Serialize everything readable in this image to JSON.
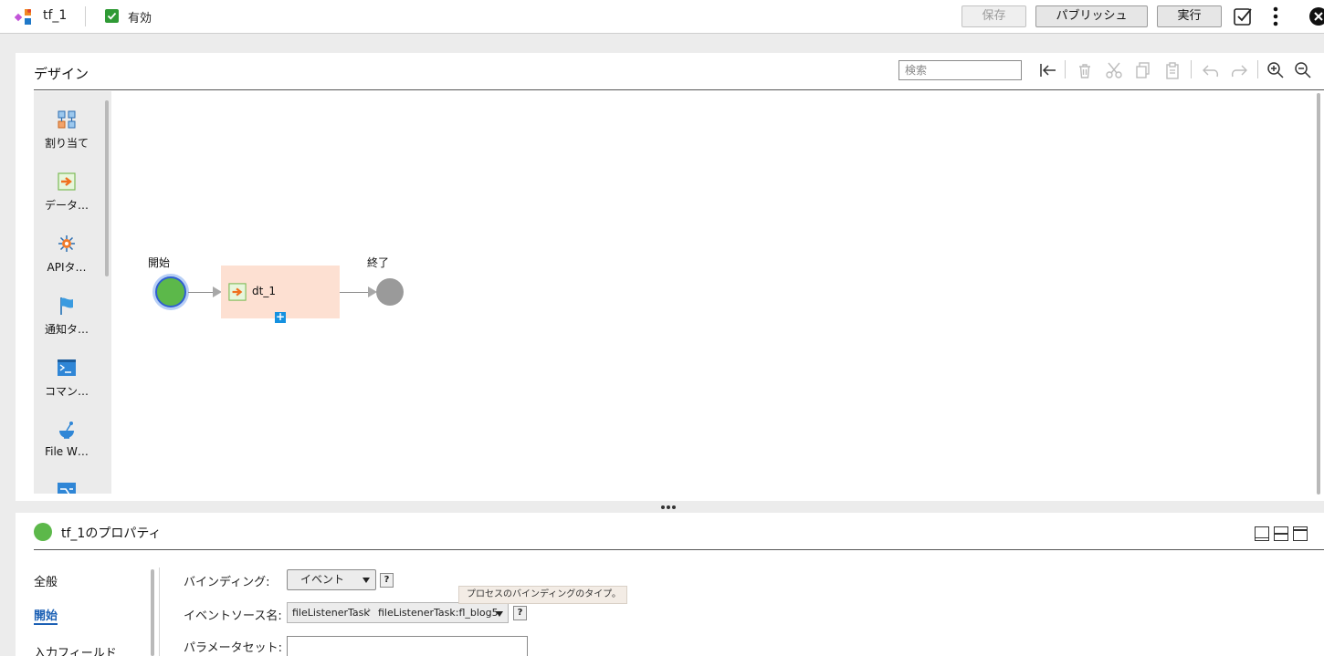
{
  "header": {
    "app_icon": "taskflow-icon",
    "title": "tf_1",
    "enabled_label": "有効",
    "enabled_checked": true,
    "buttons": {
      "save": "保存",
      "publish": "パブリッシュ",
      "run": "実行"
    },
    "icons": [
      "validate-icon",
      "kebab-menu-icon",
      "close-icon"
    ]
  },
  "design": {
    "title": "デザイン",
    "search_placeholder": "検索",
    "toolbar_icons": [
      "collapse-left-icon",
      "delete-icon",
      "cut-icon",
      "copy-icon",
      "paste-icon",
      "undo-icon",
      "redo-icon",
      "zoom-in-icon",
      "zoom-out-icon"
    ],
    "palette": [
      {
        "label": "割り当て",
        "icon": "assignment-icon"
      },
      {
        "label": "データ…",
        "icon": "data-task-icon"
      },
      {
        "label": "APIタ…",
        "icon": "api-task-icon"
      },
      {
        "label": "通知タ…",
        "icon": "notification-flag-icon"
      },
      {
        "label": "コマン…",
        "icon": "command-terminal-icon"
      },
      {
        "label": "File W…",
        "icon": "file-watch-icon"
      }
    ],
    "flow": {
      "start_label": "開始",
      "task_label": "dt_1",
      "end_label": "終了"
    }
  },
  "properties": {
    "title": "tf_1のプロパティ",
    "tabs": [
      "全般",
      "開始",
      "入力フィールド"
    ],
    "active_tab": "開始",
    "fields": {
      "binding_label": "バインディング:",
      "binding_value": "イベント",
      "event_source_label": "イベントソース名:",
      "event_source_part1": "fileListenerTask",
      "event_source_part2": "fileListenerTask:fl_blog5",
      "param_set_label": "パラメータセット:",
      "param_set_value": "",
      "help": "?"
    },
    "tooltip": "プロセスのバインディングのタイプ。",
    "colors": {
      "accent": "#1a5fb4",
      "start": "#5cb84a",
      "task": "#fde0d2",
      "end": "#9a9a9a"
    }
  }
}
